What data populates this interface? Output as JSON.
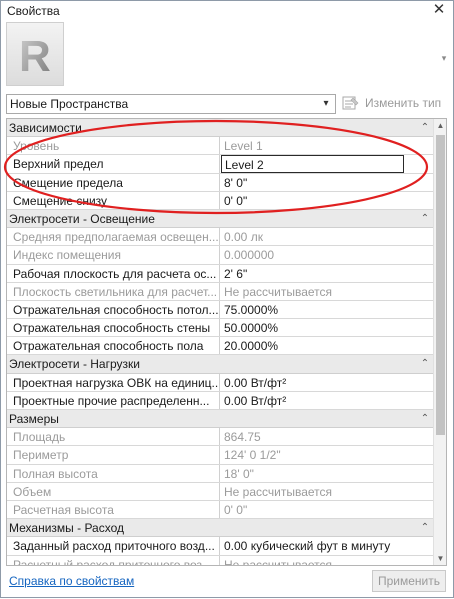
{
  "window": {
    "title": "Свойства",
    "close_glyph": "✕"
  },
  "type_preview": {
    "logo_letter": "R",
    "scroll_glyph": "▾"
  },
  "type_selector": {
    "value": "Новые Пространства",
    "arrow_glyph": "▾"
  },
  "edit_type": {
    "label": "Изменить тип",
    "icon": "edit-type-icon"
  },
  "groups": [
    {
      "label": "Зависимости",
      "collapse_glyph": "⌃",
      "rows": [
        {
          "name": "Уровень",
          "value": "Level 1",
          "readonly": true
        },
        {
          "name": "Верхний предел",
          "value": "Level 2",
          "readonly": false,
          "editing": true
        },
        {
          "name": "Смещение предела",
          "value": "8'  0\"",
          "readonly": false
        },
        {
          "name": "Смещение снизу",
          "value": "0'  0\"",
          "readonly": false
        }
      ]
    },
    {
      "label": "Электросети - Освещение",
      "collapse_glyph": "⌃",
      "rows": [
        {
          "name": "Средняя предполагаемая освещен...",
          "value": "0.00 лк",
          "readonly": true
        },
        {
          "name": "Индекс помещения",
          "value": "0.000000",
          "readonly": true
        },
        {
          "name": "Рабочая плоскость для расчета ос...",
          "value": "2'  6\"",
          "readonly": false
        },
        {
          "name": "Плоскость светильника для расчет...",
          "value": "Не рассчитывается",
          "readonly": true
        },
        {
          "name": "Отражательная способность потол...",
          "value": "75.0000%",
          "readonly": false
        },
        {
          "name": "Отражательная способность стены",
          "value": "50.0000%",
          "readonly": false
        },
        {
          "name": "Отражательная способность пола",
          "value": "20.0000%",
          "readonly": false
        }
      ]
    },
    {
      "label": "Электросети - Нагрузки",
      "collapse_glyph": "⌃",
      "rows": [
        {
          "name": "Проектная нагрузка ОВК на единиц...",
          "value": "0.00 Вт/фт²",
          "readonly": false
        },
        {
          "name": "Проектные прочие распределенн...",
          "value": "0.00 Вт/фт²",
          "readonly": false
        }
      ]
    },
    {
      "label": "Размеры",
      "collapse_glyph": "⌃",
      "rows": [
        {
          "name": "Площадь",
          "value": "864.75",
          "readonly": true
        },
        {
          "name": "Периметр",
          "value": "124'  0 1/2\"",
          "readonly": true
        },
        {
          "name": "Полная высота",
          "value": "18'  0\"",
          "readonly": true
        },
        {
          "name": "Объем",
          "value": "Не рассчитывается",
          "readonly": true
        },
        {
          "name": "Расчетная высота",
          "value": "0'  0\"",
          "readonly": true
        }
      ]
    },
    {
      "label": "Механизмы - Расход",
      "collapse_glyph": "⌃",
      "rows": [
        {
          "name": "Заданный расход приточного возд...",
          "value": "0.00 кубический фут в минуту",
          "readonly": false
        },
        {
          "name": "Расчетный расход приточного воз...",
          "value": "Не рассчитывается",
          "readonly": true
        }
      ]
    }
  ],
  "scrollbar": {
    "up_glyph": "▲",
    "down_glyph": "▼"
  },
  "footer": {
    "help_link": "Справка по свойствам",
    "apply_label": "Применить"
  },
  "colors": {
    "annotation_ring": "#e02020",
    "link": "#1565c0",
    "group_bg": "#eaeaea"
  }
}
